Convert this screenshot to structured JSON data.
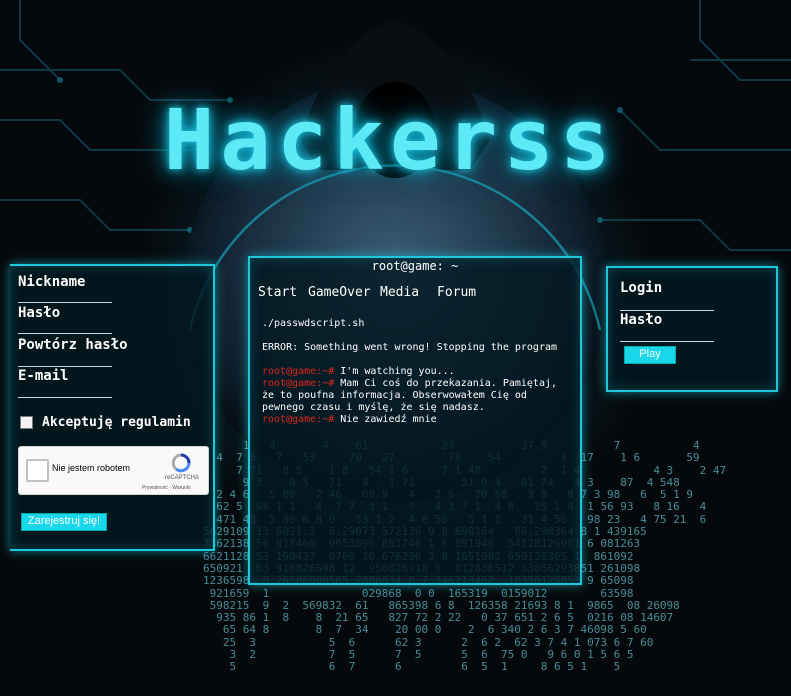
{
  "brand": {
    "logo_text": "Hackerss"
  },
  "register": {
    "nickname_label": "Nickname",
    "password_label": "Hasło",
    "repeat_password_label": "Powtórz hasło",
    "email_label": "E-mail",
    "accept_label": "Akceptuję regulamin",
    "submit_label": "Zarejestruj się!"
  },
  "captcha": {
    "label": "Nie jestem robotem",
    "brand": "reCAPTCHA",
    "links": "Prywatność - Warunki"
  },
  "terminal": {
    "title": "root@game: ~",
    "nav": [
      "Start",
      "GameOver",
      "Media",
      "Forum"
    ],
    "command": "./passwdscript.sh",
    "error": "ERROR: Something went wrong! Stopping the program",
    "prompt": "root@game:~#",
    "lines": [
      "I'm watching you...",
      "Mam Ci coś do przekazania. Pamiętaj,",
      "że to poufna informacja. Obserwowałem Cię od",
      "pewnego czasu i myślę, że się nadasz.",
      "Nie zawiedź mnie"
    ]
  },
  "login": {
    "login_label": "Login",
    "password_label": "Hasło",
    "play_label": "Play"
  },
  "colors": {
    "accent": "#1bc8dc",
    "prompt": "#e0261b",
    "button": "#19d7e8"
  }
}
